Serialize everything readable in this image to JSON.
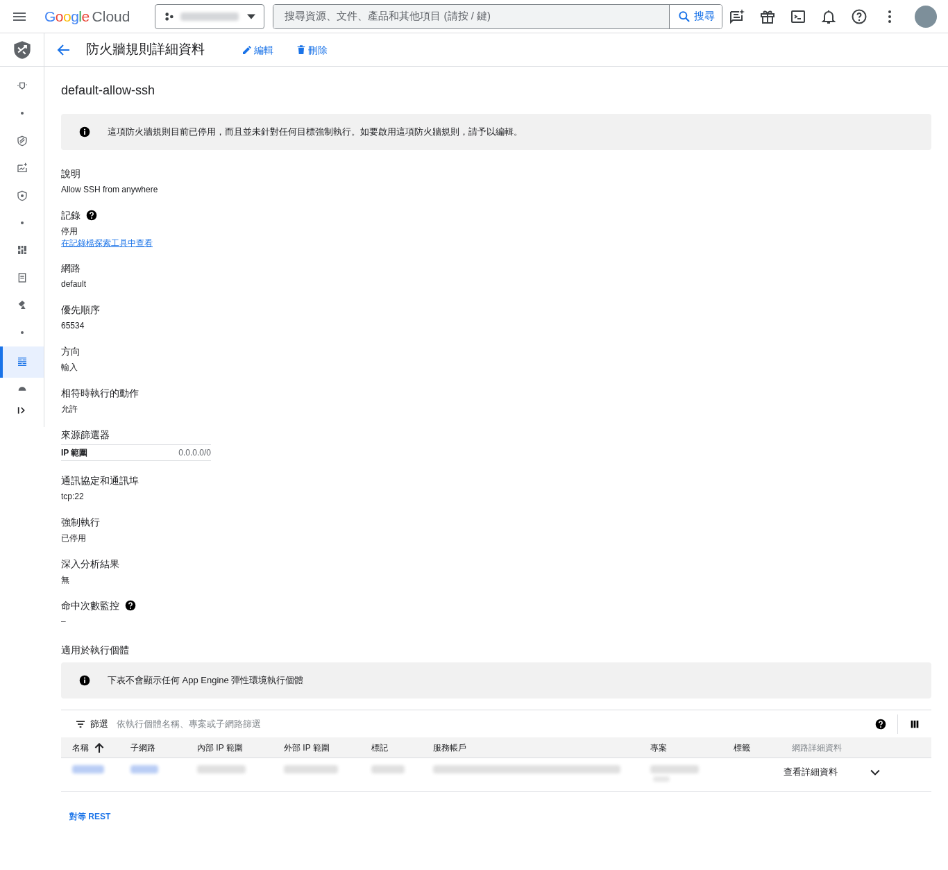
{
  "header": {
    "logo_google": "Google",
    "logo_cloud": "Cloud",
    "search": {
      "placeholder": "搜尋資源、文件、產品和其他項目 (請按 / 鍵)",
      "button": "搜尋"
    }
  },
  "page_bar": {
    "title": "防火牆規則詳細資料",
    "actions": [
      {
        "kind": "edit",
        "label": "編輯"
      },
      {
        "kind": "delete",
        "label": "刪除"
      }
    ]
  },
  "sidebar": {
    "items": [
      {
        "kind": "icon",
        "selected": false
      },
      {
        "kind": "dot",
        "selected": false
      },
      {
        "kind": "icon",
        "selected": false
      },
      {
        "kind": "icon",
        "selected": false
      },
      {
        "kind": "icon",
        "selected": false
      },
      {
        "kind": "dot",
        "selected": false
      },
      {
        "kind": "icon",
        "selected": false
      },
      {
        "kind": "icon",
        "selected": false
      },
      {
        "kind": "icon",
        "selected": false
      },
      {
        "kind": "dot",
        "selected": false
      },
      {
        "kind": "icon",
        "selected": true
      },
      {
        "kind": "icon",
        "selected": false
      }
    ]
  },
  "rule_name": "default-allow-ssh",
  "notice": "這項防火牆規則目前已停用，而且並未針對任何目標強制執行。如要啟用這項防火牆規則，請予以編輯。",
  "fields": [
    {
      "kind": "text",
      "label": "說明",
      "value": "Allow SSH from anywhere",
      "help_icon": false
    },
    {
      "kind": "text",
      "label": "記錄",
      "value": "停用",
      "link": "在記錄檔探索工具中查看",
      "help_icon": true
    },
    {
      "kind": "text",
      "label": "網路",
      "value": "default",
      "help_icon": false
    },
    {
      "kind": "text",
      "label": "優先順序",
      "value": "65534",
      "help_icon": false
    },
    {
      "kind": "text",
      "label": "方向",
      "value": "輸入",
      "help_icon": false
    },
    {
      "kind": "text",
      "label": "相符時執行的動作",
      "value": "允許",
      "help_icon": false
    },
    {
      "kind": "table",
      "label": "來源篩選器",
      "rows": [
        {
          "key": "IP 範圍",
          "value": "0.0.0.0/0"
        }
      ],
      "help_icon": false
    },
    {
      "kind": "text",
      "label": "通訊協定和通訊埠",
      "value": "tcp:22",
      "help_icon": false
    },
    {
      "kind": "text",
      "label": "強制執行",
      "value": "已停用",
      "help_icon": false
    },
    {
      "kind": "text",
      "label": "深入分析結果",
      "value": "無",
      "help_icon": false
    },
    {
      "kind": "text",
      "label": "命中次數監控",
      "value": "–",
      "help_icon": true
    }
  ],
  "instances": {
    "title": "適用於執行個體",
    "notice": "下表不會顯示任何 App Engine 彈性環境執行個體",
    "filter_label": "篩選",
    "filter_placeholder": "依執行個體名稱、專案或子網路篩選",
    "columns": [
      {
        "label": "名稱",
        "sorted": true,
        "disabled": false
      },
      {
        "label": "子網路",
        "sorted": false,
        "disabled": false
      },
      {
        "label": "內部 IP 範圍",
        "sorted": false,
        "disabled": false
      },
      {
        "label": "外部 IP 範圍",
        "sorted": false,
        "disabled": false
      },
      {
        "label": "標記",
        "sorted": false,
        "disabled": false
      },
      {
        "label": "服務帳戶",
        "sorted": false,
        "disabled": false
      },
      {
        "label": "專案",
        "sorted": false,
        "disabled": false
      },
      {
        "label": "標籤",
        "sorted": false,
        "disabled": false
      },
      {
        "label": "網路詳細資料",
        "sorted": false,
        "disabled": true
      }
    ],
    "rows": [
      {
        "network_details": "查看詳細資料",
        "expanded": false
      }
    ]
  },
  "rest_link": "對等 REST"
}
